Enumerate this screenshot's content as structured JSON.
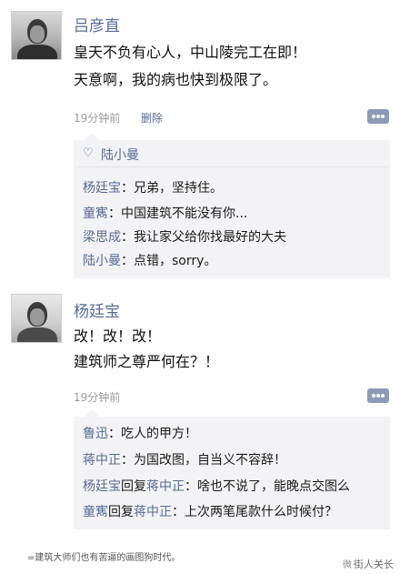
{
  "post1": {
    "author": "吕彦直",
    "lines": [
      "皇天不负有心人，中山陵完工在即！",
      "天意啊，我的病也快到极限了。"
    ],
    "time": "19分钟前",
    "delete_label": "删除",
    "likes": {
      "icon": "heart-icon",
      "names": "陆小曼"
    },
    "comments": [
      {
        "author": "杨廷宝",
        "text": "：兄弟，坚持住。"
      },
      {
        "author": "童寯",
        "text": "：中国建筑不能没有你..."
      },
      {
        "author": "梁思成",
        "text": "：我让家父给你找最好的大夫"
      },
      {
        "author": "陆小曼",
        "text": "：点错，sorry。"
      }
    ]
  },
  "post2": {
    "author": "杨廷宝",
    "lines": [
      "改！改！改！",
      "建筑师之尊严何在？！"
    ],
    "time": "19分钟前",
    "comments": [
      {
        "author": "鲁迅",
        "text": "：吃人的甲方！"
      },
      {
        "author": "蒋中正",
        "text": "：为国改图，自当义不容辞！"
      },
      {
        "author": "杨廷宝",
        "reply_word": "回复",
        "target": "蒋中正",
        "text": "：啥也不说了，能晚点交图么"
      },
      {
        "author": "童寯",
        "reply_word": "回复",
        "target": "蒋中正",
        "text": "：上次两笔尾款什么时候付？"
      }
    ]
  },
  "footer": {
    "caption": "=建筑大师们也有苦逼的画图狗时代。",
    "watermark": "街人关长",
    "watermark_logo": "微"
  },
  "colors": {
    "link": "#576b95",
    "comment_bg": "#f3f3f5",
    "more_button": "#8d9bb7"
  }
}
